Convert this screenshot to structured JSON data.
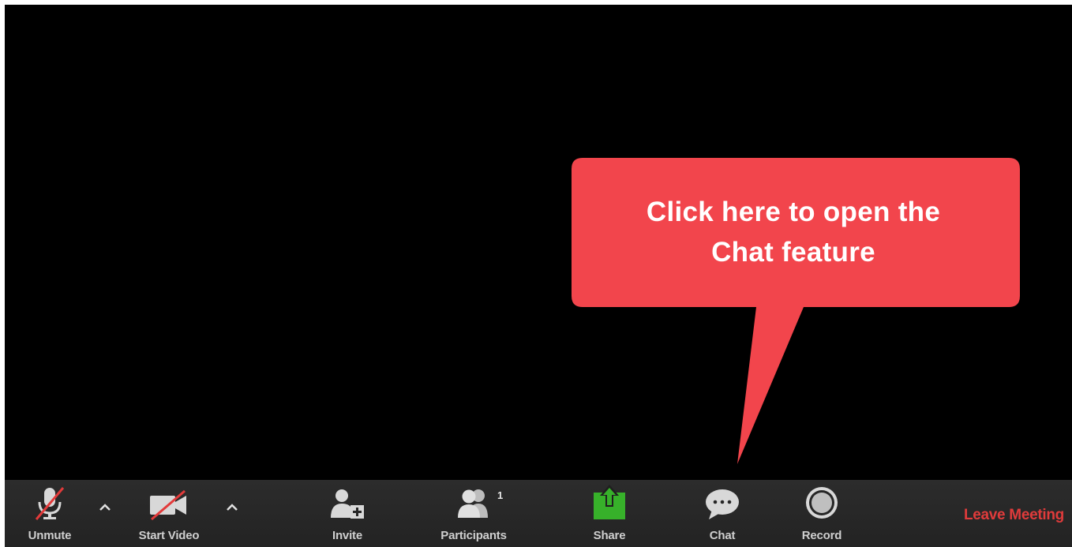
{
  "toolbar": {
    "unmute_label": "Unmute",
    "start_video_label": "Start Video",
    "invite_label": "Invite",
    "participants_label": "Participants",
    "participants_count": "1",
    "share_label": "Share",
    "chat_label": "Chat",
    "record_label": "Record",
    "leave_label": "Leave Meeting"
  },
  "callout": {
    "line1": "Click here to open the",
    "line2": "Chat feature"
  },
  "colors": {
    "callout": "#f2454c",
    "share_green": "#37b12a",
    "leave_red": "#e03b3b",
    "toolbar_bg": "#262626"
  },
  "icons": [
    "microphone-muted-icon",
    "video-off-icon",
    "chevron-up-icon",
    "invite-user-icon",
    "participants-icon",
    "share-screen-icon",
    "chat-bubble-icon",
    "record-icon"
  ]
}
